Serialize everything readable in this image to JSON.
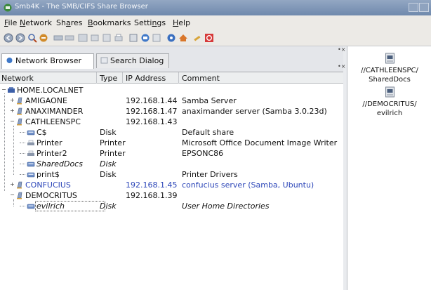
{
  "window": {
    "title": "Smb4K - The SMB/CIFS Share Browser"
  },
  "menu": [
    {
      "label": "File",
      "key": "F"
    },
    {
      "label": "Network",
      "key": "N"
    },
    {
      "label": "Shares",
      "key": "a"
    },
    {
      "label": "Bookmarks",
      "key": "B"
    },
    {
      "label": "Settings",
      "key": "n"
    },
    {
      "label": "Help",
      "key": "H"
    }
  ],
  "toolbar": {
    "icons": [
      "back-icon",
      "forward-icon",
      "scan-network-icon",
      "abort-icon",
      "mount-icon",
      "unmount-icon",
      "unmount-all-icon",
      "search-icon",
      "preview-icon",
      "print-icon",
      "add-bookmark-icon",
      "mount-dialog-icon",
      "info-icon",
      "home-icon",
      "config-icon",
      "quit-icon"
    ]
  },
  "tabs": {
    "network_browser": "Network Browser",
    "search_dialog": "Search Dialog"
  },
  "table": {
    "columns": [
      "Network",
      "Type",
      "IP Address",
      "Comment"
    ],
    "rows": [
      {
        "name": "HOME.LOCALNET",
        "type": "",
        "ip": "",
        "comment": "",
        "level": 0,
        "kind": "workgroup",
        "expander": "−"
      },
      {
        "name": "AMIGAONE",
        "type": "",
        "ip": "192.168.1.44",
        "comment": "Samba Server",
        "level": 1,
        "kind": "host",
        "expander": "+"
      },
      {
        "name": "ANAXIMANDER",
        "type": "",
        "ip": "192.168.1.47",
        "comment": "anaximander server (Samba 3.0.23d)",
        "level": 1,
        "kind": "host",
        "expander": "+"
      },
      {
        "name": "CATHLEENSPC",
        "type": "",
        "ip": "192.168.1.43",
        "comment": "",
        "level": 1,
        "kind": "host",
        "expander": "−"
      },
      {
        "name": "C$",
        "type": "Disk",
        "ip": "",
        "comment": "Default share",
        "level": 2,
        "kind": "disk"
      },
      {
        "name": "Printer",
        "type": "Printer",
        "ip": "",
        "comment": "Microsoft Office Document Image Writer",
        "level": 2,
        "kind": "printer"
      },
      {
        "name": "Printer2",
        "type": "Printer",
        "ip": "",
        "comment": "EPSONC86",
        "level": 2,
        "kind": "printer"
      },
      {
        "name": "SharedDocs",
        "type": "Disk",
        "ip": "",
        "comment": "",
        "level": 2,
        "kind": "disk",
        "style": "italic"
      },
      {
        "name": "print$",
        "type": "Disk",
        "ip": "",
        "comment": "Printer Drivers",
        "level": 2,
        "kind": "disk"
      },
      {
        "name": "CONFUCIUS",
        "type": "",
        "ip": "192.168.1.45",
        "comment": "confucius server (Samba, Ubuntu)",
        "level": 1,
        "kind": "host",
        "expander": "+",
        "style": "blue"
      },
      {
        "name": "DEMOCRITUS",
        "type": "",
        "ip": "192.168.1.39",
        "comment": "",
        "level": 1,
        "kind": "host",
        "expander": "−"
      },
      {
        "name": "evilrich",
        "type": "Disk",
        "ip": "",
        "comment": "User Home Directories",
        "level": 2,
        "kind": "disk",
        "style": "italic selected"
      }
    ]
  },
  "mounted_shares": [
    {
      "label_line1": "//CATHLEENSPC/",
      "label_line2": "SharedDocs"
    },
    {
      "label_line1": "//DEMOCRITUS/",
      "label_line2": "evilrich"
    }
  ],
  "colors": {
    "titlebar": "#7f97b8",
    "link_blue": "#2b45b8",
    "window_bg": "#e9ebee"
  }
}
